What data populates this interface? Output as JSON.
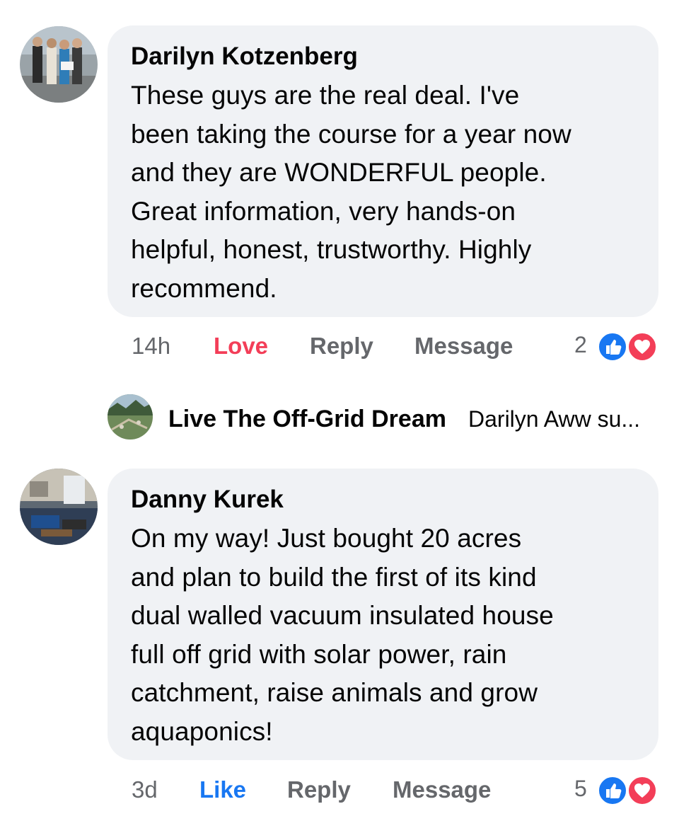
{
  "comments": [
    {
      "author": "Darilyn Kotzenberg",
      "lines": [
        "These guys are the real deal. I've",
        "been taking the course for a year now",
        "and they are WONDERFUL people.",
        "Great information, very hands-on",
        "helpful, honest, trustworthy. Highly",
        "recommend."
      ],
      "time": "14h",
      "reaction_action": "Love",
      "reply_label": "Reply",
      "message_label": "Message",
      "reaction_count": "2",
      "reaction_icons": [
        "like-icon",
        "heart-icon"
      ]
    },
    {
      "author": "Danny Kurek",
      "lines": [
        "On my way! Just bought 20 acres",
        "and plan to build the first of its kind",
        "dual walled vacuum insulated house",
        "full off grid with solar power, rain",
        "catchment, raise animals and grow",
        "aquaponics!"
      ],
      "time": "3d",
      "reaction_action": "Like",
      "reply_label": "Reply",
      "message_label": "Message",
      "reaction_count": "5",
      "reaction_icons": [
        "like-icon",
        "heart-icon"
      ]
    }
  ],
  "reply_preview": {
    "author": "Live The Off-Grid Dream",
    "snippet": "Darilyn Aww su..."
  },
  "colors": {
    "bubble": "#f0f2f5",
    "love": "#f33e58",
    "like": "#1877f2",
    "muted": "#65676b"
  }
}
